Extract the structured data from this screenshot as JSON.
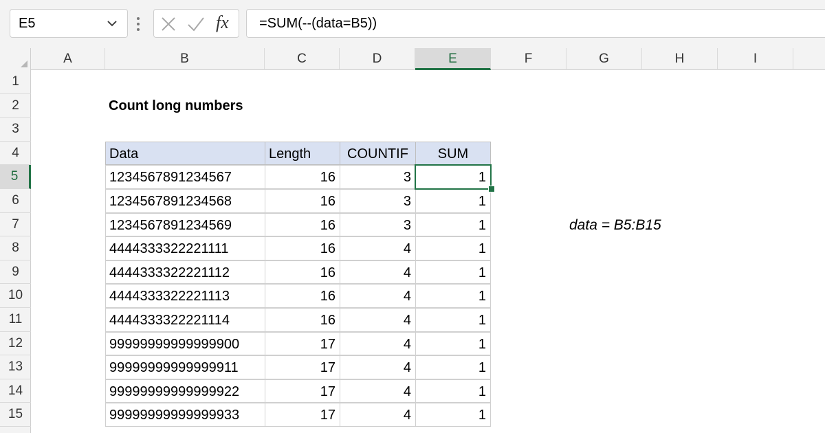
{
  "formula_bar": {
    "name_box": "E5",
    "formula": "=SUM(--(data=B5))",
    "fx_label": "fx",
    "icons": [
      "chevron-down-icon",
      "vertical-dots-icon",
      "cancel-x-icon",
      "enter-check-icon",
      "fx-icon"
    ]
  },
  "columns": [
    "A",
    "B",
    "C",
    "D",
    "E",
    "F",
    "G",
    "H",
    "I"
  ],
  "selected_column": "E",
  "rows": [
    "1",
    "2",
    "3",
    "4",
    "5",
    "6",
    "7",
    "8",
    "9",
    "10",
    "11",
    "12",
    "13",
    "14",
    "15"
  ],
  "selected_row": "5",
  "sheet": {
    "title": "Count long numbers",
    "headers": [
      "Data",
      "Length",
      "COUNTIF",
      "SUM"
    ],
    "data": [
      [
        "1234567891234567",
        "16",
        "3",
        "1"
      ],
      [
        "1234567891234568",
        "16",
        "3",
        "1"
      ],
      [
        "1234567891234569",
        "16",
        "3",
        "1"
      ],
      [
        "4444333322221111",
        "16",
        "4",
        "1"
      ],
      [
        "4444333322221112",
        "16",
        "4",
        "1"
      ],
      [
        "4444333322221113",
        "16",
        "4",
        "1"
      ],
      [
        "4444333322221114",
        "16",
        "4",
        "1"
      ],
      [
        "99999999999999900",
        "17",
        "4",
        "1"
      ],
      [
        "99999999999999911",
        "17",
        "4",
        "1"
      ],
      [
        "99999999999999922",
        "17",
        "4",
        "1"
      ],
      [
        "99999999999999933",
        "17",
        "4",
        "1"
      ]
    ],
    "named_range_note": "data = B5:B15"
  },
  "colors": {
    "accent": "#217346",
    "header_fill": "#d9e1f2",
    "chrome": "#f3f3f3"
  }
}
